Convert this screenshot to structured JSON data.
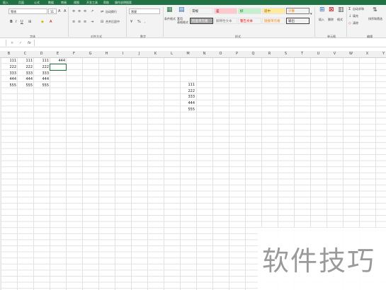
{
  "ribbon_tabs": [
    "插入",
    "页面",
    "公式",
    "数据",
    "审阅",
    "视图",
    "开发工具",
    "帮助",
    "操作说明搜索"
  ],
  "font": {
    "name": "等线",
    "size": "11"
  },
  "number_format": "常规",
  "labels": {
    "wrap": "自动换行",
    "merge": "合并后居中",
    "cond_format": "条件格式",
    "table_format": "套用\n表格格式",
    "insert": "插入",
    "delete": "删除",
    "format": "格式",
    "autosum": "自动求和",
    "fill": "填充",
    "clear": "清除",
    "sort": "排序和筛选"
  },
  "groups": [
    "字体",
    "对齐方式",
    "数字",
    "样式",
    "单元格",
    "编辑"
  ],
  "styles": [
    {
      "name": "常规",
      "bg": "#ffffff",
      "color": "#000000",
      "border": "#bdbdbd"
    },
    {
      "name": "差",
      "bg": "#ffc7ce",
      "color": "#9c0006",
      "border": "#e4e4e4"
    },
    {
      "name": "好",
      "bg": "#c6efce",
      "color": "#006100",
      "border": "#e4e4e4"
    },
    {
      "name": "适中",
      "bg": "#ffeb9c",
      "color": "#9c5700",
      "border": "#e4e4e4"
    },
    {
      "name": "计算",
      "bg": "#f2f2f2",
      "color": "#fa7d00",
      "border": "#7f7f7f"
    },
    {
      "name": "检查单元格",
      "bg": "#a5a5a5",
      "color": "#ffffff",
      "border": "#3f3f3f"
    },
    {
      "name": "解释性文本",
      "bg": "#ffffff",
      "color": "#7f7f7f",
      "border": "#e4e4e4"
    },
    {
      "name": "警告文本",
      "bg": "#ffffff",
      "color": "#ff0000",
      "border": "#e4e4e4"
    },
    {
      "name": "链接单元格",
      "bg": "#ffffff",
      "color": "#fa7d00",
      "border": "#e4e4e4"
    },
    {
      "name": "输出",
      "bg": "#f2f2f2",
      "color": "#3f3f3f",
      "border": "#3f3f3f"
    }
  ],
  "formula_bar": {
    "fx": "fx",
    "cancel": "×",
    "enter": "✓"
  },
  "columns": [
    "B",
    "C",
    "D",
    "E",
    "F",
    "G",
    "H",
    "I",
    "J",
    "K",
    "L",
    "M",
    "N",
    "O",
    "P",
    "Q",
    "R",
    "S",
    "T",
    "U",
    "V",
    "W",
    "X",
    "Y"
  ],
  "cells": [
    {
      "text": "111"
    },
    {
      "text": "111"
    },
    {
      "text": "111"
    },
    {
      "text": "444"
    },
    {
      "text": "222"
    },
    {
      "text": "222"
    },
    {
      "text": "222"
    },
    {
      "text": "333"
    },
    {
      "text": "333"
    },
    {
      "text": "333"
    },
    {
      "text": "444"
    },
    {
      "text": "444"
    },
    {
      "text": "444"
    },
    {
      "text": "555"
    },
    {
      "text": "555"
    },
    {
      "text": "555"
    },
    {
      "text": "111"
    },
    {
      "text": "222"
    },
    {
      "text": "333"
    },
    {
      "text": "444"
    },
    {
      "text": "555"
    }
  ],
  "watermark": "软件技巧",
  "colors": {
    "accent": "#217346"
  }
}
